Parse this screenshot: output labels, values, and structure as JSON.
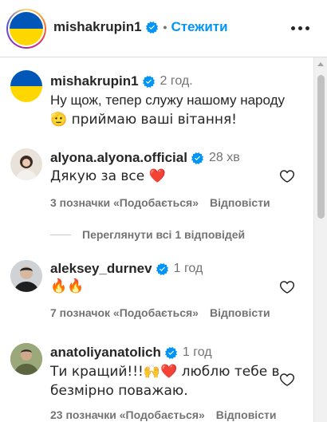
{
  "header": {
    "username": "mishakrupin1",
    "separator": "•",
    "follow_label": "Стежити"
  },
  "colors": {
    "accent": "#0095f6",
    "verified": "#0095f6",
    "heart": "#ed4956",
    "muted": "#737373"
  },
  "caption": {
    "username": "mishakrupin1",
    "time": "2 год.",
    "line1": "Ну щож, тепер служу нашому народу",
    "line2": "🫡 приймаю ваші вітання!"
  },
  "comments": [
    {
      "username": "alyona.alyona.official",
      "time": "28 хв",
      "text": "Дякую за все ❤️",
      "likes": "3 позначки «Подобається»",
      "reply": "Відповісти"
    },
    {
      "username": "aleksey_durnev",
      "time": "1 год",
      "text": "🔥🔥",
      "likes": "7 позначок «Подобається»",
      "reply": "Відповісти"
    },
    {
      "username": "anatoliyanatolich",
      "time": "1 год",
      "text_line1": "Ти кращий!!!🙌❤️ люблю тебе в",
      "text_line2": "безмірно поважаю.",
      "likes": "23 позначки «Подобається»",
      "reply": "Відповісти"
    }
  ],
  "view_replies": "Переглянути всі 1 відповідей"
}
